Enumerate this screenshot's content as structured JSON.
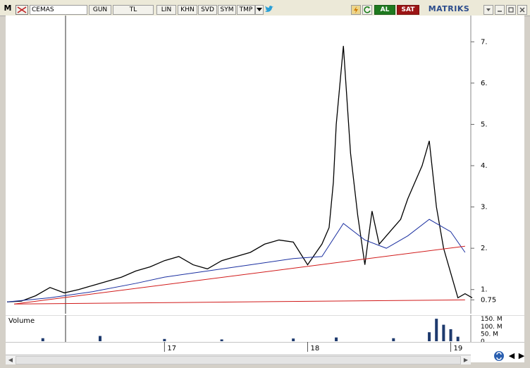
{
  "toolbar": {
    "logo": "M",
    "symbol": "CEMAS",
    "period": "GUN",
    "currency": "TL",
    "scale": "LIN",
    "khn": "KHN",
    "svd": "SVD",
    "sym": "SYM",
    "tmp": "TMP",
    "buy_label": "AL",
    "sell_label": "SAT",
    "brand": "MATRIKS",
    "colors": {
      "buy": "#1f7a1f",
      "sell": "#9c1515",
      "brand": "#2b4c8c"
    }
  },
  "chart": {
    "y_tick_labels": [
      "7.",
      "6.",
      "5.",
      "4.",
      "3.",
      "2.",
      "1.",
      "0.75"
    ],
    "x_tick_labels": [
      "17",
      "18",
      "19"
    ],
    "volume_label": "Volume",
    "volume_tick_labels": [
      "150. M",
      "100. M",
      "50. M",
      "0."
    ],
    "colors": {
      "price": "#000000",
      "moving_average": "#1a2fa0",
      "trendline": "#d11a1a"
    }
  },
  "chart_data": {
    "type": "line",
    "series": [
      {
        "values_x_years": [
          2015.9,
          2016.0,
          2016.1,
          2016.2,
          2016.3,
          2016.4,
          2016.5,
          2016.6,
          2016.7,
          2016.8,
          2016.9,
          2017.0,
          2017.1,
          2017.2,
          2017.3,
          2017.4,
          2017.5,
          2017.6,
          2017.7,
          2017.8,
          2017.9,
          2018.0,
          2018.05,
          2018.1,
          2018.15,
          2018.18,
          2018.2,
          2018.25,
          2018.3,
          2018.35,
          2018.4,
          2018.45,
          2018.5,
          2018.55,
          2018.6,
          2018.65,
          2018.7,
          2018.75,
          2018.8,
          2018.85,
          2018.9,
          2018.95,
          2019.0,
          2019.05,
          2019.1,
          2019.15
        ],
        "values_y": [
          0.7,
          0.72,
          0.85,
          1.05,
          0.92,
          1.0,
          1.1,
          1.2,
          1.3,
          1.45,
          1.55,
          1.7,
          1.8,
          1.6,
          1.5,
          1.7,
          1.8,
          1.9,
          2.1,
          2.2,
          2.15,
          1.6,
          1.85,
          2.1,
          2.5,
          3.6,
          5.0,
          6.9,
          4.3,
          2.8,
          1.6,
          2.9,
          2.1,
          2.3,
          2.5,
          2.7,
          3.2,
          3.6,
          4.0,
          4.6,
          3.0,
          2.0,
          1.4,
          0.8,
          0.9,
          0.8
        ]
      },
      {
        "values_x_years": [
          2015.9,
          2016.2,
          2016.5,
          2016.8,
          2017.0,
          2017.3,
          2017.6,
          2017.9,
          2018.1,
          2018.25,
          2018.4,
          2018.55,
          2018.7,
          2018.85,
          2019.0,
          2019.1
        ],
        "values_y": [
          0.7,
          0.8,
          0.95,
          1.15,
          1.3,
          1.45,
          1.6,
          1.75,
          1.8,
          2.6,
          2.2,
          2.0,
          2.3,
          2.7,
          2.4,
          1.9
        ]
      },
      {
        "values_x_years": [
          2015.95,
          2019.1
        ],
        "values_y": [
          0.65,
          2.05
        ]
      },
      {
        "values_x_years": [
          2015.95,
          2019.1
        ],
        "values_y": [
          0.65,
          0.75
        ]
      }
    ],
    "volume": {
      "values_x_years": [
        2016.15,
        2016.55,
        2017.0,
        2017.4,
        2017.9,
        2018.2,
        2018.6,
        2018.85,
        2018.9,
        2018.95,
        2019.0,
        2019.05
      ],
      "values_y": [
        20,
        35,
        15,
        12,
        18,
        25,
        20,
        60,
        150,
        110,
        80,
        30
      ]
    },
    "ylim": [
      0.5,
      7.5
    ],
    "volume_ylim": [
      0,
      160
    ]
  }
}
